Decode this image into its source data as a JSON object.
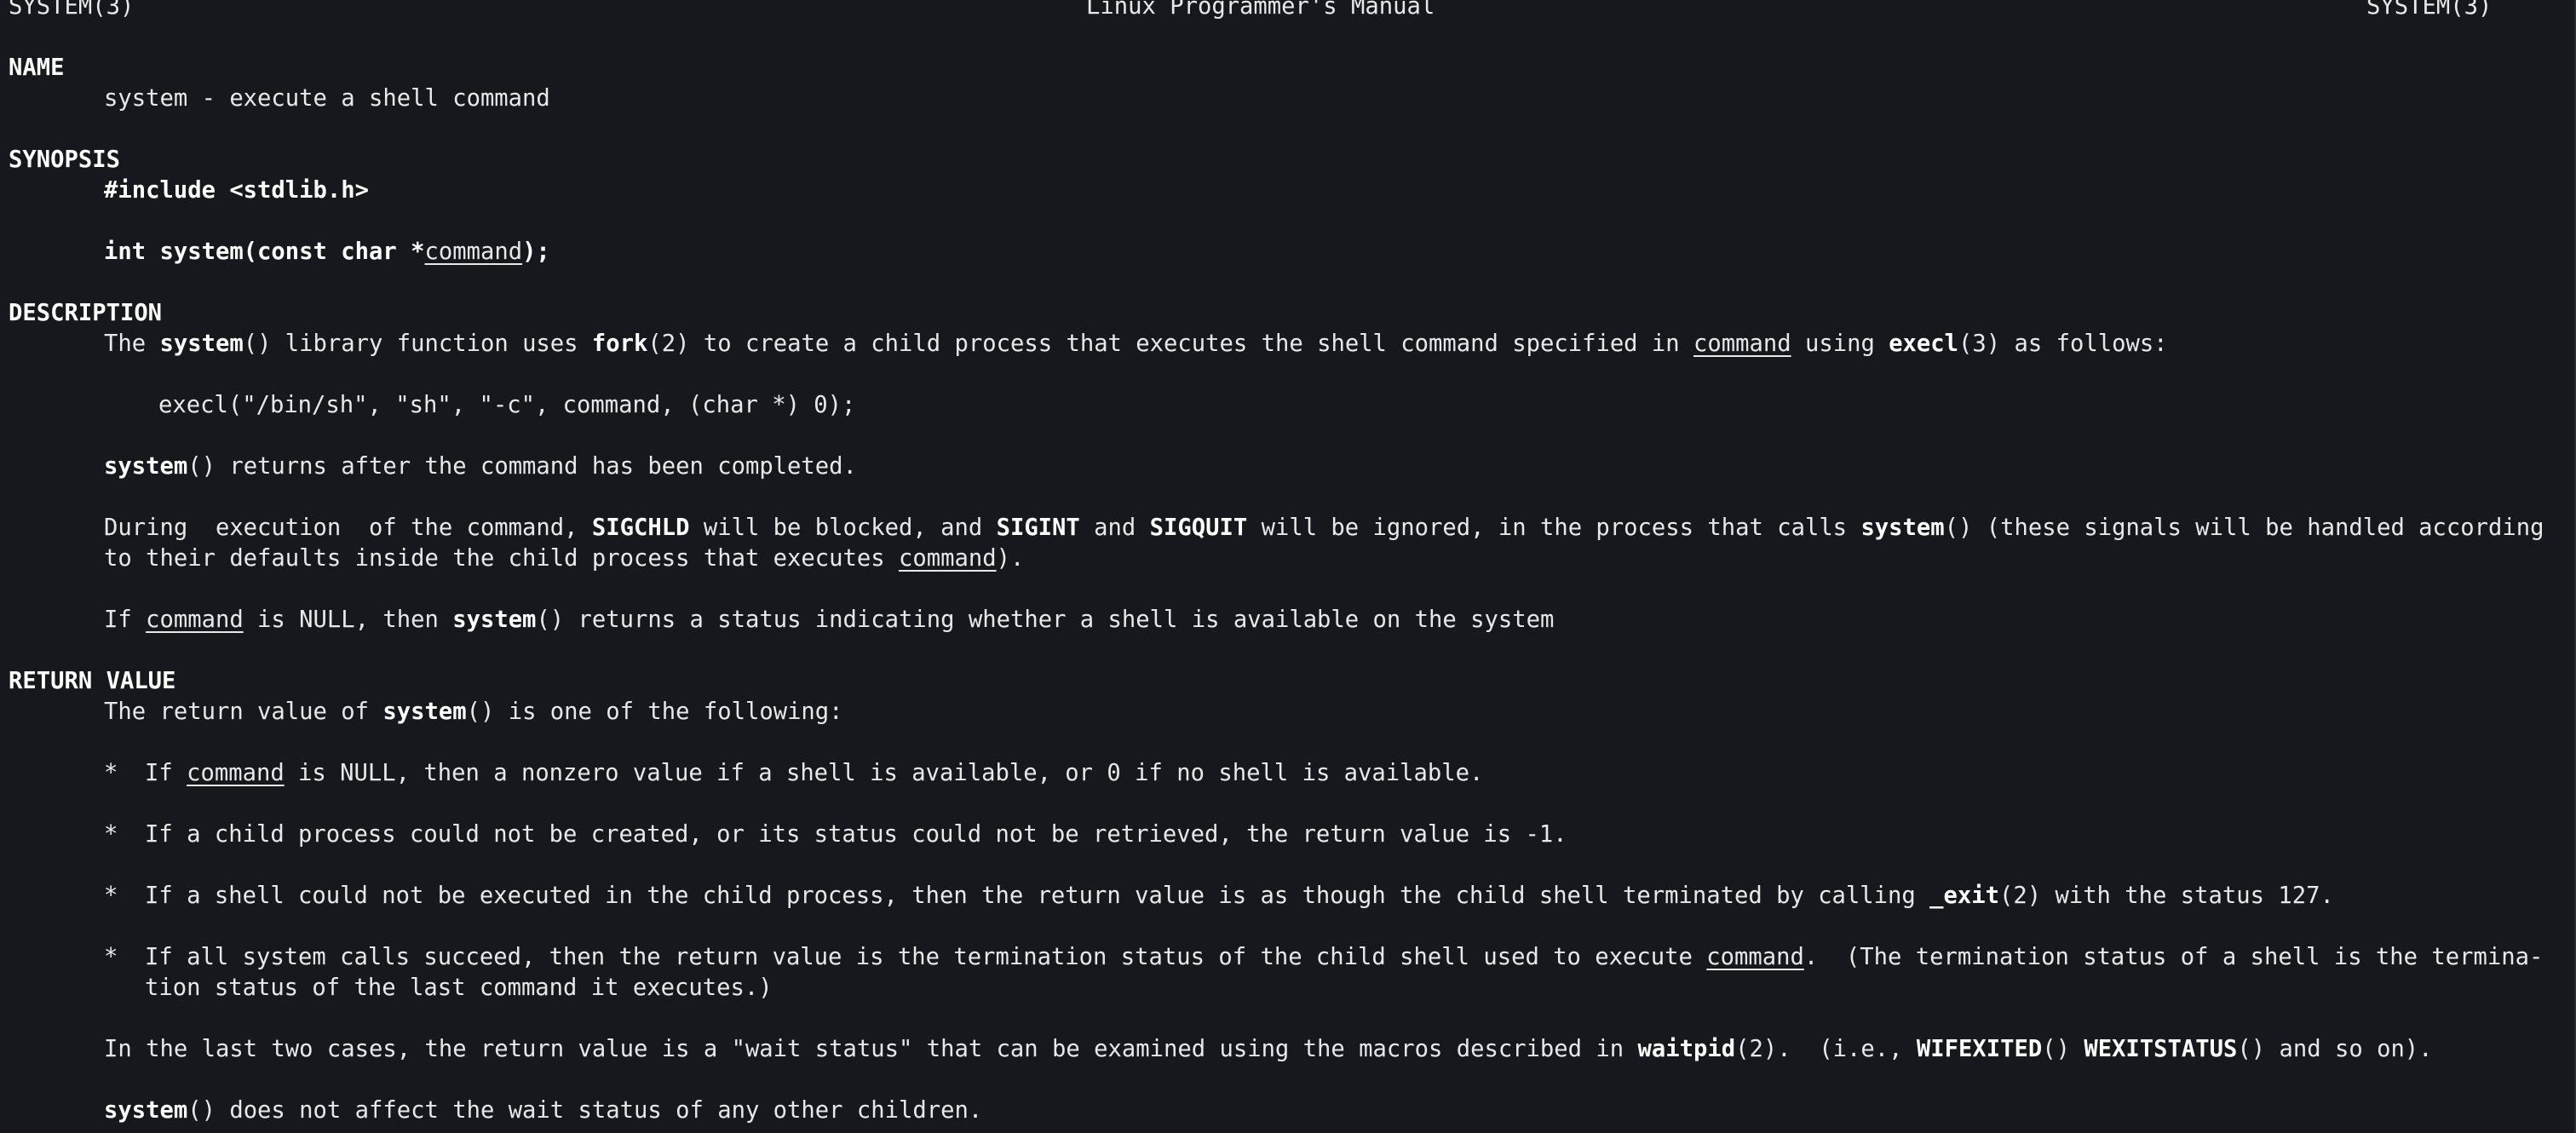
{
  "header": {
    "left": "SYSTEM(3)",
    "center": "Linux Programmer's Manual",
    "right": "SYSTEM(3)"
  },
  "name": {
    "heading": "NAME",
    "text": "system - execute a shell command"
  },
  "synopsis": {
    "heading": "SYNOPSIS",
    "include": "#include <stdlib.h>",
    "proto_a": "int system(const char *",
    "proto_arg": "command",
    "proto_b": ");"
  },
  "description": {
    "heading": "DESCRIPTION",
    "p1": {
      "t1": "The ",
      "b1": "system",
      "t2": "() library function uses ",
      "b2": "fork",
      "t3": "(2) to create a child process that executes the shell command specified in ",
      "u1": "command",
      "t4": " using ",
      "b3": "execl",
      "t5": "(3) as follows:"
    },
    "code": "execl(\"/bin/sh\", \"sh\", \"-c\", command, (char *) 0);",
    "p2": {
      "b1": "system",
      "t1": "() returns after the command has been completed."
    },
    "p3": {
      "t1": "During  execution  of the command, ",
      "b1": "SIGCHLD",
      "t2": " will be blocked, and ",
      "b2": "SIGINT",
      "t3": " and ",
      "b3": "SIGQUIT",
      "t4": " will be ignored, in the process that calls ",
      "b4": "system",
      "t5": "() (these signals will be handled according",
      "line2_a": "to their defaults inside the child process that executes ",
      "line2_u": "command",
      "line2_b": ")."
    },
    "p4": {
      "t1": "If ",
      "u1": "command",
      "t2": " is NULL, then ",
      "b1": "system",
      "t3": "() returns a status indicating whether a shell is available on the system"
    }
  },
  "return_value": {
    "heading": "RETURN VALUE",
    "intro_a": "The return value of ",
    "intro_b": "system",
    "intro_c": "() is one of the following:",
    "bullet": "*",
    "item1_a": "If ",
    "item1_u": "command",
    "item1_b": " is NULL, then a nonzero value if a shell is available, or 0 if no shell is available.",
    "item2": "If a child process could not be created, or its status could not be retrieved, the return value is -1.",
    "item3_a": "If a shell could not be executed in the child process, then the return value is as though the child shell terminated by calling ",
    "item3_b": "_exit",
    "item3_c": "(2) with the status 127.",
    "item4_a": "If all system calls succeed, then the return value is the termination status of the child shell used to execute ",
    "item4_u": "command",
    "item4_b": ".  (The termination status of a shell is the termina-",
    "item4_line2": "tion status of the last command it executes.)",
    "p_last_a": "In the last two cases, the return value is a \"wait status\" that can be examined using the macros described in ",
    "p_last_b": "waitpid",
    "p_last_c": "(2).  (i.e., ",
    "p_last_d": "WIFEXITED",
    "p_last_e": "() ",
    "p_last_f": "WEXITSTATUS",
    "p_last_g": "() and so on).",
    "final_b": "system",
    "final_t": "() does not affect the wait status of any other children."
  }
}
